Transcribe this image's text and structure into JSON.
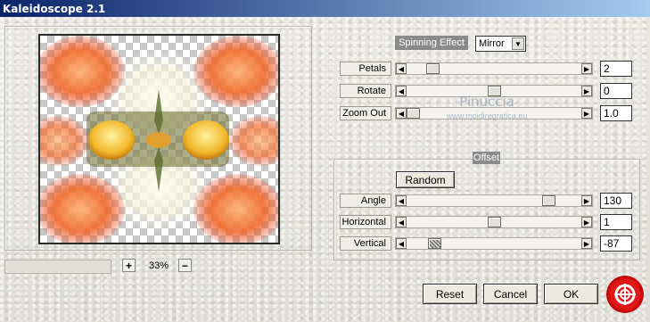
{
  "window": {
    "title": "Kaleidoscope 2.1"
  },
  "zoom": {
    "plus_label": "+",
    "minus_label": "−",
    "value": "33%"
  },
  "effect": {
    "label": "Spinning Effect",
    "selected": "Mirror"
  },
  "sliders": {
    "petals": {
      "label": "Petals",
      "value": "2",
      "position": 0.12
    },
    "rotate": {
      "label": "Rotate",
      "value": "0",
      "position": 0.5
    },
    "zoom_out": {
      "label": "Zoom Out",
      "value": "1.0",
      "position": 0.0
    },
    "angle": {
      "label": "Angle",
      "value": "130",
      "position": 0.84
    },
    "horizontal": {
      "label": "Horizontal",
      "value": "1",
      "position": 0.5
    },
    "vertical": {
      "label": "Vertical",
      "value": "-87",
      "position": 0.13
    }
  },
  "offset": {
    "label": "Offset",
    "random_label": "Random"
  },
  "watermark": {
    "line1": "Pinuccia",
    "line2": "www.moidiregrafica.eu"
  },
  "buttons": {
    "reset": "Reset",
    "cancel": "Cancel",
    "ok": "OK"
  },
  "icons": {
    "left_arrow": "left-arrow-icon",
    "right_arrow": "right-arrow-icon",
    "dropdown": "chevron-down-icon",
    "logo": "lifebuoy-logo-icon"
  },
  "colors": {
    "titlebar_start": "#0a246a",
    "titlebar_end": "#a6caf0",
    "logo": "#e01818"
  }
}
